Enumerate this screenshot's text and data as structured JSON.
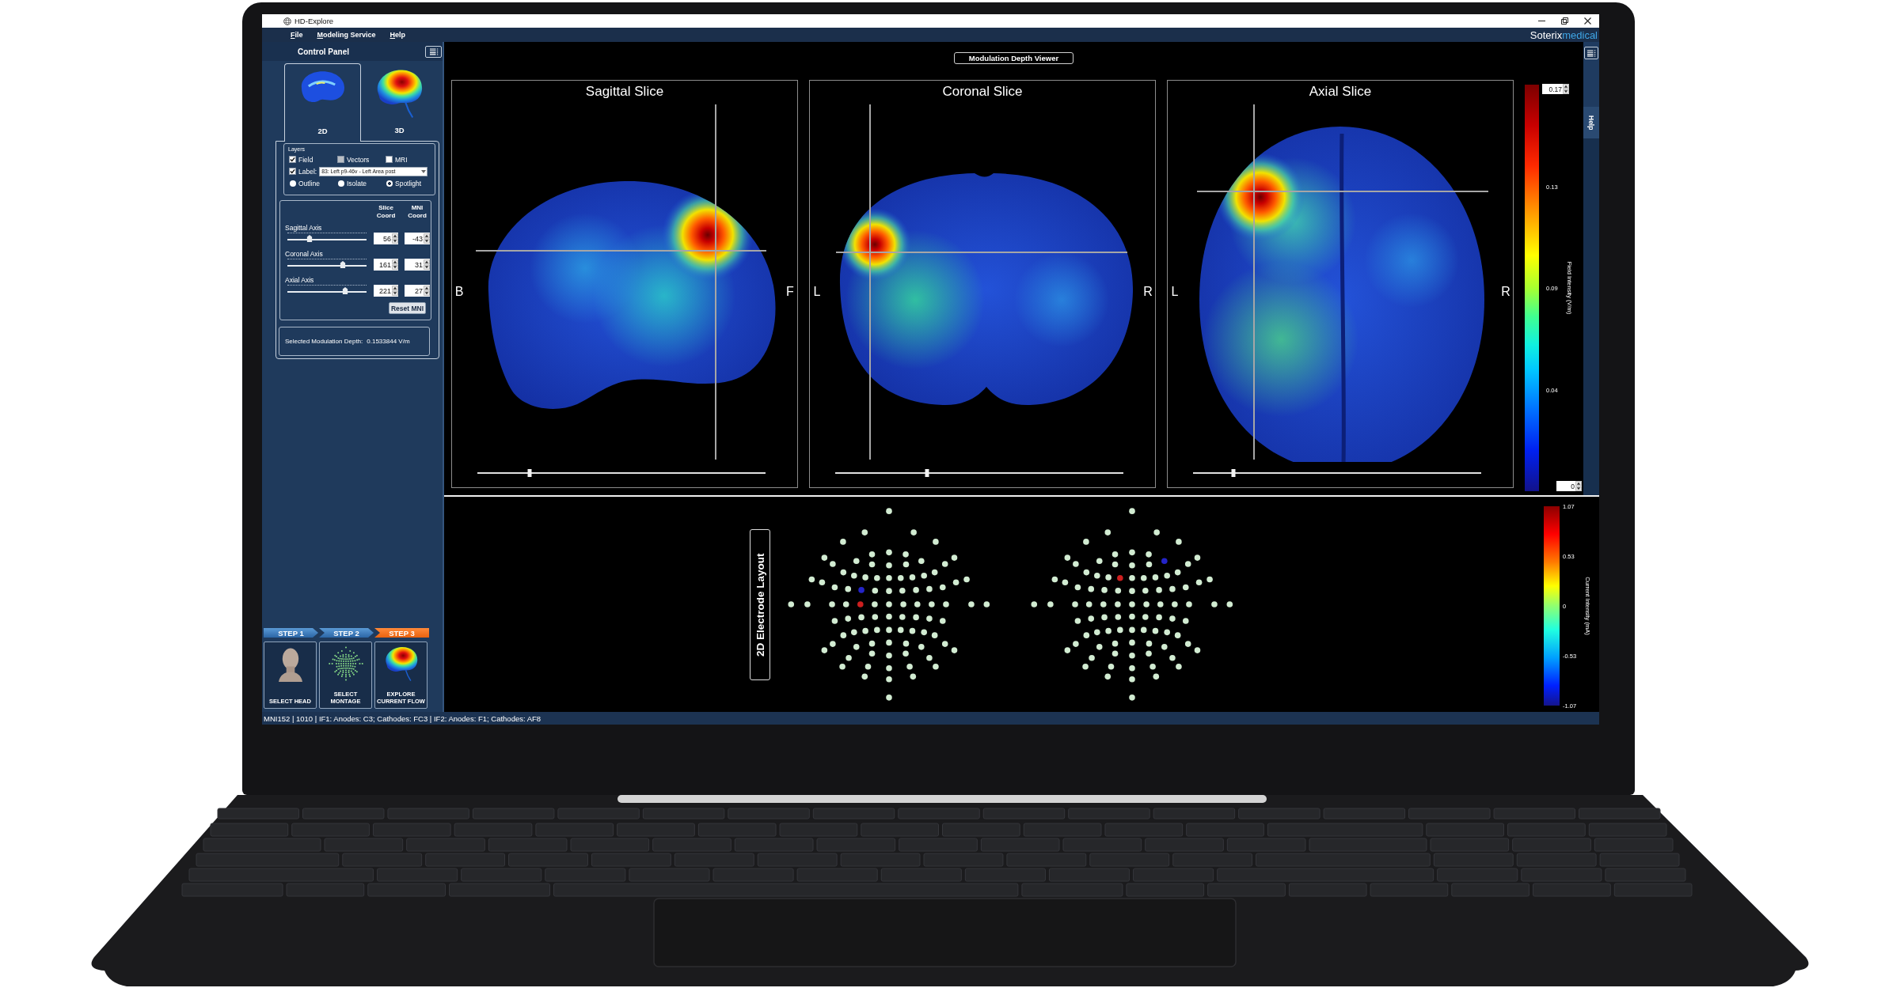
{
  "window": {
    "title": "HD-Explore"
  },
  "menu": [
    {
      "label": "File"
    },
    {
      "label": "Modeling Service"
    },
    {
      "label": "Help"
    }
  ],
  "logo": {
    "main": "Soterix",
    "accent": "medical"
  },
  "control_panel": {
    "title": "Control Panel",
    "view_tabs": [
      {
        "label": "2D",
        "kind": "slice",
        "selected": true
      },
      {
        "label": "3D",
        "kind": "volume",
        "selected": false
      }
    ],
    "layers": {
      "title": "Layers",
      "checkboxes": [
        {
          "label": "Field",
          "checked": true,
          "disabled": false
        },
        {
          "label": "Vectors",
          "checked": false,
          "disabled": true
        },
        {
          "label": "MRI",
          "checked": false,
          "disabled": false
        }
      ],
      "label_filter": {
        "label": "Label:",
        "checked": true,
        "value": "83: Left p9-46v - Left Area post"
      },
      "display_modes": [
        {
          "label": "Outline",
          "selected": false
        },
        {
          "label": "Isolate",
          "selected": false
        },
        {
          "label": "Spotlight",
          "selected": true
        }
      ]
    },
    "axes": {
      "columns": [
        "Slice\nCoord",
        "MNI\nCoord"
      ],
      "rows": [
        {
          "name": "Sagittal Axis",
          "level": 0.28,
          "slice_coord": "56",
          "mni_coord": "-43"
        },
        {
          "name": "Coronal Axis",
          "level": 0.7,
          "slice_coord": "161",
          "mni_coord": "31"
        },
        {
          "name": "Axial Axis",
          "level": 0.73,
          "slice_coord": "221",
          "mni_coord": "27"
        }
      ],
      "reset_button": "Reset MNI"
    },
    "modulation_depth": {
      "label": "Selected Modulation Depth:",
      "value": "0.1533844 V/m"
    }
  },
  "steps": [
    {
      "label": "STEP 1",
      "selected": false,
      "kind": "head",
      "tile": "SELECT HEAD"
    },
    {
      "label": "STEP 2",
      "selected": false,
      "kind": "montage",
      "tile": "SELECT\nMONTAGE"
    },
    {
      "label": "STEP 3",
      "selected": true,
      "kind": "brain",
      "tile": "EXPLORE\nCURRENT FLOW"
    }
  ],
  "viewer": {
    "title": "Modulation Depth Viewer",
    "slices": [
      {
        "title": "Sagittal Slice",
        "kind": "sagittal",
        "left": "B",
        "right": "F",
        "level": 0.18
      },
      {
        "title": "Coronal Slice",
        "kind": "coronal",
        "left": "L",
        "right": "R",
        "level": 0.32
      },
      {
        "title": "Axial Slice",
        "kind": "axial",
        "left": "L",
        "right": "R",
        "level": 0.14
      }
    ],
    "colorbar": {
      "max": "0.17",
      "ticks": [
        "0.13",
        "0.09",
        "0.04"
      ],
      "min": "0",
      "title": "Field Intensity (V/m)"
    }
  },
  "help_tab": {
    "label": "Help"
  },
  "electrode_layout": {
    "title": "2D Electrode Layout",
    "maps": [
      {
        "electrodes": [
          {
            "color": "#d2ecd2"
          },
          {
            "color": "#d2ecd2"
          },
          {
            "color": "#d2ecd2"
          },
          {
            "color": "#d2ecd2"
          },
          {
            "color": "#d2ecd2"
          },
          {
            "color": "#d2ecd2"
          },
          {
            "color": "#d2ecd2"
          },
          {
            "color": "#d2ecd2"
          },
          {
            "color": "#d2ecd2"
          },
          {
            "color": "#d2ecd2"
          },
          {
            "color": "#d2ecd2"
          },
          {
            "color": "#d2ecd2"
          },
          {
            "color": "#d2ecd2"
          },
          {
            "color": "#d2ecd2"
          },
          {
            "color": "#d2ecd2"
          },
          {
            "color": "#d2ecd2"
          },
          {
            "color": "#d2ecd2"
          },
          {
            "color": "#d2ecd2"
          },
          {
            "color": "#d2ecd2"
          },
          {
            "color": "#d2ecd2"
          },
          {
            "color": "#d2ecd2"
          },
          {
            "color": "#d2ecd2"
          },
          {
            "color": "#d2ecd2"
          },
          {
            "color": "#d2ecd2"
          },
          {
            "color": "#d2ecd2"
          },
          {
            "color": "#d2ecd2"
          },
          {
            "color": "#d2ecd2"
          },
          {
            "color": "#d2ecd2"
          },
          {
            "color": "#d2ecd2"
          },
          {
            "color": "#d2ecd2"
          },
          {
            "color": "#d2ecd2"
          },
          {
            "color": "#d2ecd2"
          },
          {
            "color": "#2424c8"
          },
          {
            "color": "#d2ecd2"
          },
          {
            "color": "#d2ecd2"
          },
          {
            "color": "#d2ecd2"
          },
          {
            "color": "#d2ecd2"
          },
          {
            "color": "#d2ecd2"
          },
          {
            "color": "#d2ecd2"
          },
          {
            "color": "#d2ecd2"
          },
          {
            "color": "#d2ecd2"
          },
          {
            "color": "#d2ecd2"
          },
          {
            "color": "#d2ecd2"
          },
          {
            "color": "#cc1f1f"
          },
          {
            "color": "#d2ecd2"
          },
          {
            "color": "#d2ecd2"
          },
          {
            "color": "#d2ecd2"
          },
          {
            "color": "#d2ecd2"
          },
          {
            "color": "#d2ecd2"
          },
          {
            "color": "#d2ecd2"
          },
          {
            "color": "#d2ecd2"
          },
          {
            "color": "#d2ecd2"
          },
          {
            "color": "#d2ecd2"
          },
          {
            "color": "#d2ecd2"
          },
          {
            "color": "#d2ecd2"
          },
          {
            "color": "#d2ecd2"
          },
          {
            "color": "#d2ecd2"
          },
          {
            "color": "#d2ecd2"
          },
          {
            "color": "#d2ecd2"
          },
          {
            "color": "#d2ecd2"
          },
          {
            "color": "#d2ecd2"
          },
          {
            "color": "#d2ecd2"
          },
          {
            "color": "#d2ecd2"
          },
          {
            "color": "#d2ecd2"
          },
          {
            "color": "#d2ecd2"
          },
          {
            "color": "#d2ecd2"
          },
          {
            "color": "#d2ecd2"
          },
          {
            "color": "#d2ecd2"
          },
          {
            "color": "#d2ecd2"
          },
          {
            "color": "#d2ecd2"
          },
          {
            "color": "#d2ecd2"
          },
          {
            "color": "#d2ecd2"
          },
          {
            "color": "#d2ecd2"
          },
          {
            "color": "#d2ecd2"
          },
          {
            "color": "#d2ecd2"
          },
          {
            "color": "#d2ecd2"
          },
          {
            "color": "#d2ecd2"
          },
          {
            "color": "#d2ecd2"
          },
          {
            "color": "#d2ecd2"
          },
          {
            "color": "#d2ecd2"
          },
          {
            "color": "#d2ecd2"
          },
          {
            "color": "#d2ecd2"
          },
          {
            "color": "#d2ecd2"
          },
          {
            "color": "#d2ecd2"
          },
          {
            "color": "#d2ecd2"
          },
          {
            "color": "#d2ecd2"
          },
          {
            "color": "#d2ecd2"
          },
          {
            "color": "#d2ecd2"
          },
          {
            "color": "#d2ecd2"
          },
          {
            "color": "#d2ecd2"
          },
          {
            "color": "#d2ecd2"
          },
          {
            "color": "#d2ecd2"
          },
          {
            "color": "#d2ecd2"
          }
        ]
      },
      {
        "electrodes": [
          {
            "color": "#d2ecd2"
          },
          {
            "color": "#d2ecd2"
          },
          {
            "color": "#d2ecd2"
          },
          {
            "color": "#d2ecd2"
          },
          {
            "color": "#d2ecd2"
          },
          {
            "color": "#d2ecd2"
          },
          {
            "color": "#d2ecd2"
          },
          {
            "color": "#d2ecd2"
          },
          {
            "color": "#d2ecd2"
          },
          {
            "color": "#d2ecd2"
          },
          {
            "color": "#d2ecd2"
          },
          {
            "color": "#2424c8"
          },
          {
            "color": "#d2ecd2"
          },
          {
            "color": "#d2ecd2"
          },
          {
            "color": "#d2ecd2"
          },
          {
            "color": "#d2ecd2"
          },
          {
            "color": "#d2ecd2"
          },
          {
            "color": "#d2ecd2"
          },
          {
            "color": "#d2ecd2"
          },
          {
            "color": "#d2ecd2"
          },
          {
            "color": "#d2ecd2"
          },
          {
            "color": "#cc1f1f"
          },
          {
            "color": "#d2ecd2"
          },
          {
            "color": "#d2ecd2"
          },
          {
            "color": "#d2ecd2"
          },
          {
            "color": "#d2ecd2"
          },
          {
            "color": "#d2ecd2"
          },
          {
            "color": "#d2ecd2"
          },
          {
            "color": "#d2ecd2"
          },
          {
            "color": "#d2ecd2"
          },
          {
            "color": "#d2ecd2"
          },
          {
            "color": "#d2ecd2"
          },
          {
            "color": "#d2ecd2"
          },
          {
            "color": "#d2ecd2"
          },
          {
            "color": "#d2ecd2"
          },
          {
            "color": "#d2ecd2"
          },
          {
            "color": "#d2ecd2"
          },
          {
            "color": "#d2ecd2"
          },
          {
            "color": "#d2ecd2"
          },
          {
            "color": "#d2ecd2"
          },
          {
            "color": "#d2ecd2"
          },
          {
            "color": "#d2ecd2"
          },
          {
            "color": "#d2ecd2"
          },
          {
            "color": "#d2ecd2"
          },
          {
            "color": "#d2ecd2"
          },
          {
            "color": "#d2ecd2"
          },
          {
            "color": "#d2ecd2"
          },
          {
            "color": "#d2ecd2"
          },
          {
            "color": "#d2ecd2"
          },
          {
            "color": "#d2ecd2"
          },
          {
            "color": "#d2ecd2"
          },
          {
            "color": "#d2ecd2"
          },
          {
            "color": "#d2ecd2"
          },
          {
            "color": "#d2ecd2"
          },
          {
            "color": "#d2ecd2"
          },
          {
            "color": "#d2ecd2"
          },
          {
            "color": "#d2ecd2"
          },
          {
            "color": "#d2ecd2"
          },
          {
            "color": "#d2ecd2"
          },
          {
            "color": "#d2ecd2"
          },
          {
            "color": "#d2ecd2"
          },
          {
            "color": "#d2ecd2"
          },
          {
            "color": "#d2ecd2"
          },
          {
            "color": "#d2ecd2"
          },
          {
            "color": "#d2ecd2"
          },
          {
            "color": "#d2ecd2"
          },
          {
            "color": "#d2ecd2"
          },
          {
            "color": "#d2ecd2"
          },
          {
            "color": "#d2ecd2"
          },
          {
            "color": "#d2ecd2"
          },
          {
            "color": "#d2ecd2"
          },
          {
            "color": "#d2ecd2"
          },
          {
            "color": "#d2ecd2"
          },
          {
            "color": "#d2ecd2"
          },
          {
            "color": "#d2ecd2"
          },
          {
            "color": "#d2ecd2"
          },
          {
            "color": "#d2ecd2"
          },
          {
            "color": "#d2ecd2"
          },
          {
            "color": "#d2ecd2"
          },
          {
            "color": "#d2ecd2"
          },
          {
            "color": "#d2ecd2"
          },
          {
            "color": "#d2ecd2"
          },
          {
            "color": "#d2ecd2"
          },
          {
            "color": "#d2ecd2"
          },
          {
            "color": "#d2ecd2"
          },
          {
            "color": "#d2ecd2"
          },
          {
            "color": "#d2ecd2"
          },
          {
            "color": "#d2ecd2"
          },
          {
            "color": "#d2ecd2"
          },
          {
            "color": "#d2ecd2"
          },
          {
            "color": "#d2ecd2"
          },
          {
            "color": "#d2ecd2"
          },
          {
            "color": "#d2ecd2"
          }
        ]
      }
    ],
    "colorbar": {
      "ticks": [
        "1.07",
        "0.53",
        "0",
        "-0.53",
        "-1.07"
      ],
      "title": "Current Intensity (mA)"
    }
  },
  "status_bar": {
    "text": "MNI152 | 1010 | IF1: Anodes: C3; Cathodes: FC3 | IF2: Anodes: F1; Cathodes: AF8"
  }
}
